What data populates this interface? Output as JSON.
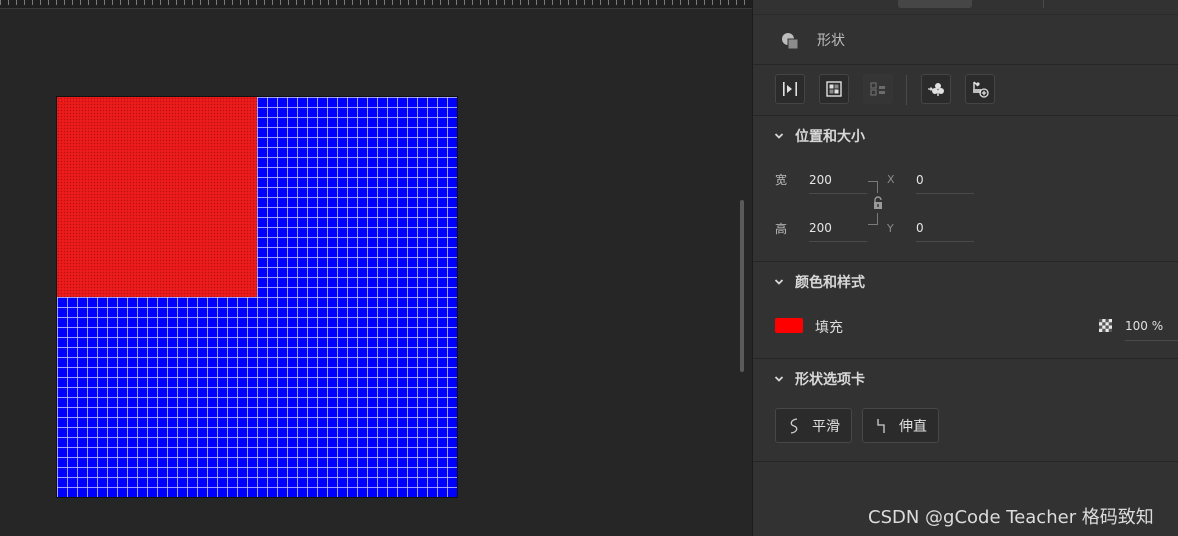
{
  "panel": {
    "header_title": "形状",
    "header_icon": "shape-icon",
    "toolbar_icons": [
      "distribute-icon",
      "align-grid-icon",
      "arrange-icon",
      "boolean-subtract-icon",
      "add-shape-icon"
    ]
  },
  "position_size": {
    "title": "位置和大小",
    "width_label": "宽",
    "width_value": "200",
    "height_label": "高",
    "height_value": "200",
    "x_label": "X",
    "x_value": "0",
    "y_label": "Y",
    "y_value": "0"
  },
  "color_style": {
    "title": "颜色和样式",
    "fill_label": "填充",
    "fill_color": "#ff0000",
    "opacity_value": "100 %"
  },
  "shape_options": {
    "title": "形状选项卡",
    "smooth_label": "平滑",
    "straighten_label": "伸直"
  },
  "canvas": {
    "background_color": "#0000ff",
    "shape_fill": "#ee1b1b"
  },
  "watermark": "CSDN @gCode Teacher  格码致知"
}
